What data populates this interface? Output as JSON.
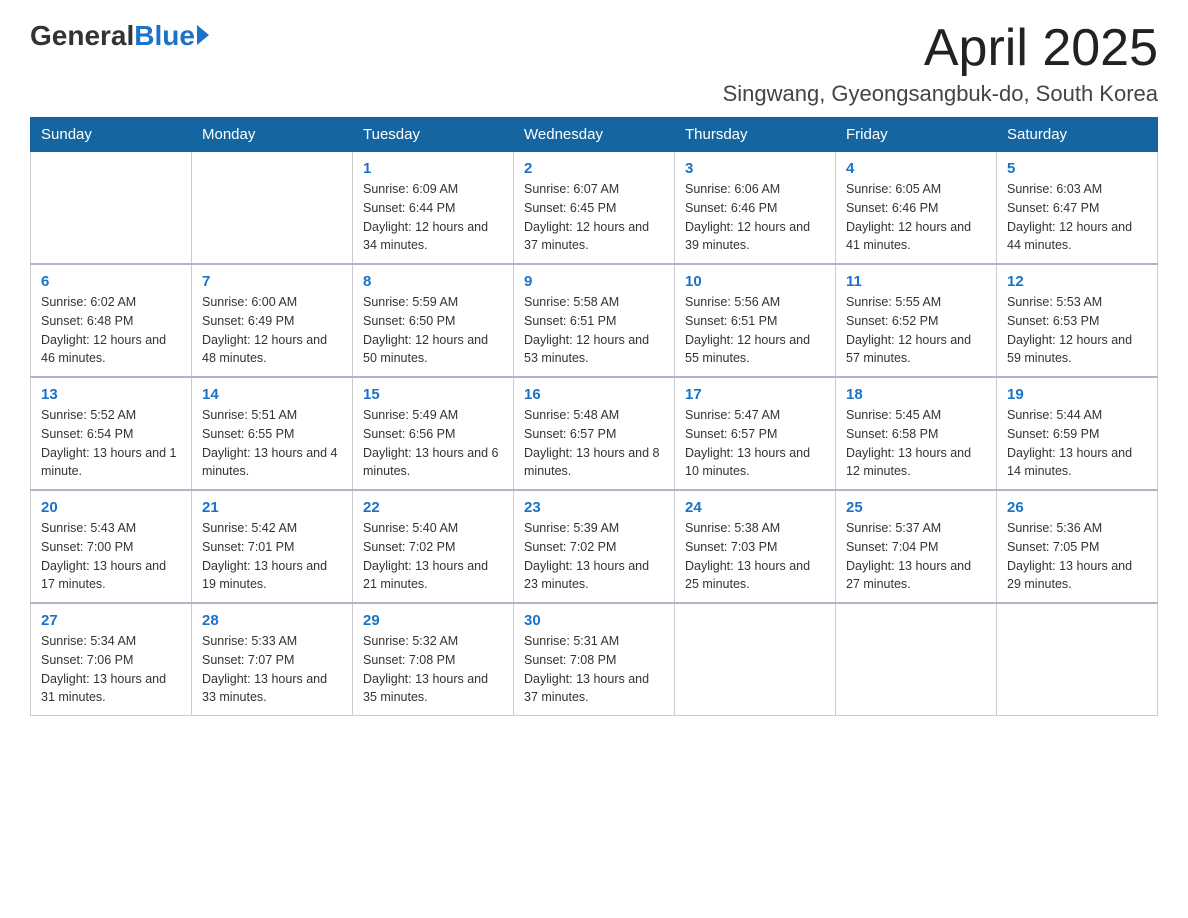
{
  "header": {
    "logo_general": "General",
    "logo_blue": "Blue",
    "month_title": "April 2025",
    "location": "Singwang, Gyeongsangbuk-do, South Korea"
  },
  "weekdays": [
    "Sunday",
    "Monday",
    "Tuesday",
    "Wednesday",
    "Thursday",
    "Friday",
    "Saturday"
  ],
  "weeks": [
    [
      {
        "day": "",
        "sunrise": "",
        "sunset": "",
        "daylight": ""
      },
      {
        "day": "",
        "sunrise": "",
        "sunset": "",
        "daylight": ""
      },
      {
        "day": "1",
        "sunrise": "Sunrise: 6:09 AM",
        "sunset": "Sunset: 6:44 PM",
        "daylight": "Daylight: 12 hours and 34 minutes."
      },
      {
        "day": "2",
        "sunrise": "Sunrise: 6:07 AM",
        "sunset": "Sunset: 6:45 PM",
        "daylight": "Daylight: 12 hours and 37 minutes."
      },
      {
        "day": "3",
        "sunrise": "Sunrise: 6:06 AM",
        "sunset": "Sunset: 6:46 PM",
        "daylight": "Daylight: 12 hours and 39 minutes."
      },
      {
        "day": "4",
        "sunrise": "Sunrise: 6:05 AM",
        "sunset": "Sunset: 6:46 PM",
        "daylight": "Daylight: 12 hours and 41 minutes."
      },
      {
        "day": "5",
        "sunrise": "Sunrise: 6:03 AM",
        "sunset": "Sunset: 6:47 PM",
        "daylight": "Daylight: 12 hours and 44 minutes."
      }
    ],
    [
      {
        "day": "6",
        "sunrise": "Sunrise: 6:02 AM",
        "sunset": "Sunset: 6:48 PM",
        "daylight": "Daylight: 12 hours and 46 minutes."
      },
      {
        "day": "7",
        "sunrise": "Sunrise: 6:00 AM",
        "sunset": "Sunset: 6:49 PM",
        "daylight": "Daylight: 12 hours and 48 minutes."
      },
      {
        "day": "8",
        "sunrise": "Sunrise: 5:59 AM",
        "sunset": "Sunset: 6:50 PM",
        "daylight": "Daylight: 12 hours and 50 minutes."
      },
      {
        "day": "9",
        "sunrise": "Sunrise: 5:58 AM",
        "sunset": "Sunset: 6:51 PM",
        "daylight": "Daylight: 12 hours and 53 minutes."
      },
      {
        "day": "10",
        "sunrise": "Sunrise: 5:56 AM",
        "sunset": "Sunset: 6:51 PM",
        "daylight": "Daylight: 12 hours and 55 minutes."
      },
      {
        "day": "11",
        "sunrise": "Sunrise: 5:55 AM",
        "sunset": "Sunset: 6:52 PM",
        "daylight": "Daylight: 12 hours and 57 minutes."
      },
      {
        "day": "12",
        "sunrise": "Sunrise: 5:53 AM",
        "sunset": "Sunset: 6:53 PM",
        "daylight": "Daylight: 12 hours and 59 minutes."
      }
    ],
    [
      {
        "day": "13",
        "sunrise": "Sunrise: 5:52 AM",
        "sunset": "Sunset: 6:54 PM",
        "daylight": "Daylight: 13 hours and 1 minute."
      },
      {
        "day": "14",
        "sunrise": "Sunrise: 5:51 AM",
        "sunset": "Sunset: 6:55 PM",
        "daylight": "Daylight: 13 hours and 4 minutes."
      },
      {
        "day": "15",
        "sunrise": "Sunrise: 5:49 AM",
        "sunset": "Sunset: 6:56 PM",
        "daylight": "Daylight: 13 hours and 6 minutes."
      },
      {
        "day": "16",
        "sunrise": "Sunrise: 5:48 AM",
        "sunset": "Sunset: 6:57 PM",
        "daylight": "Daylight: 13 hours and 8 minutes."
      },
      {
        "day": "17",
        "sunrise": "Sunrise: 5:47 AM",
        "sunset": "Sunset: 6:57 PM",
        "daylight": "Daylight: 13 hours and 10 minutes."
      },
      {
        "day": "18",
        "sunrise": "Sunrise: 5:45 AM",
        "sunset": "Sunset: 6:58 PM",
        "daylight": "Daylight: 13 hours and 12 minutes."
      },
      {
        "day": "19",
        "sunrise": "Sunrise: 5:44 AM",
        "sunset": "Sunset: 6:59 PM",
        "daylight": "Daylight: 13 hours and 14 minutes."
      }
    ],
    [
      {
        "day": "20",
        "sunrise": "Sunrise: 5:43 AM",
        "sunset": "Sunset: 7:00 PM",
        "daylight": "Daylight: 13 hours and 17 minutes."
      },
      {
        "day": "21",
        "sunrise": "Sunrise: 5:42 AM",
        "sunset": "Sunset: 7:01 PM",
        "daylight": "Daylight: 13 hours and 19 minutes."
      },
      {
        "day": "22",
        "sunrise": "Sunrise: 5:40 AM",
        "sunset": "Sunset: 7:02 PM",
        "daylight": "Daylight: 13 hours and 21 minutes."
      },
      {
        "day": "23",
        "sunrise": "Sunrise: 5:39 AM",
        "sunset": "Sunset: 7:02 PM",
        "daylight": "Daylight: 13 hours and 23 minutes."
      },
      {
        "day": "24",
        "sunrise": "Sunrise: 5:38 AM",
        "sunset": "Sunset: 7:03 PM",
        "daylight": "Daylight: 13 hours and 25 minutes."
      },
      {
        "day": "25",
        "sunrise": "Sunrise: 5:37 AM",
        "sunset": "Sunset: 7:04 PM",
        "daylight": "Daylight: 13 hours and 27 minutes."
      },
      {
        "day": "26",
        "sunrise": "Sunrise: 5:36 AM",
        "sunset": "Sunset: 7:05 PM",
        "daylight": "Daylight: 13 hours and 29 minutes."
      }
    ],
    [
      {
        "day": "27",
        "sunrise": "Sunrise: 5:34 AM",
        "sunset": "Sunset: 7:06 PM",
        "daylight": "Daylight: 13 hours and 31 minutes."
      },
      {
        "day": "28",
        "sunrise": "Sunrise: 5:33 AM",
        "sunset": "Sunset: 7:07 PM",
        "daylight": "Daylight: 13 hours and 33 minutes."
      },
      {
        "day": "29",
        "sunrise": "Sunrise: 5:32 AM",
        "sunset": "Sunset: 7:08 PM",
        "daylight": "Daylight: 13 hours and 35 minutes."
      },
      {
        "day": "30",
        "sunrise": "Sunrise: 5:31 AM",
        "sunset": "Sunset: 7:08 PM",
        "daylight": "Daylight: 13 hours and 37 minutes."
      },
      {
        "day": "",
        "sunrise": "",
        "sunset": "",
        "daylight": ""
      },
      {
        "day": "",
        "sunrise": "",
        "sunset": "",
        "daylight": ""
      },
      {
        "day": "",
        "sunrise": "",
        "sunset": "",
        "daylight": ""
      }
    ]
  ]
}
